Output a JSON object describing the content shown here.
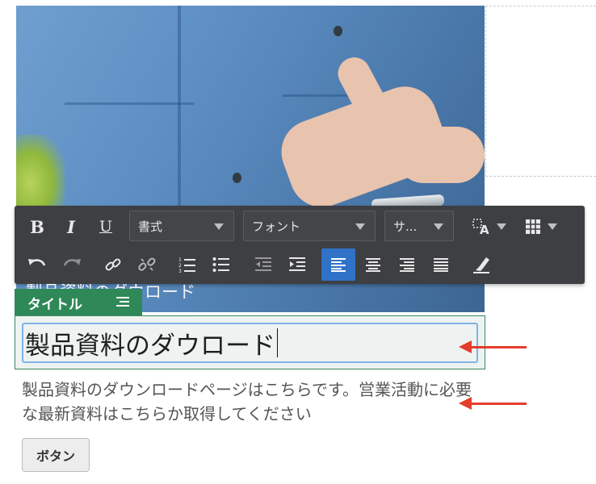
{
  "background_image": {
    "description_icon": "photo-person-with-phone"
  },
  "toolbar": {
    "bold_label": "B",
    "italic_label": "I",
    "underline_label": "U",
    "format_select": "書式",
    "font_select": "フォント",
    "size_select": "サ...",
    "icons": [
      "undo-icon",
      "redo-icon",
      "link-icon",
      "unlink-icon",
      "ordered-list-icon",
      "bullet-list-icon",
      "outdent-icon",
      "indent-icon",
      "align-left-icon",
      "align-center-icon",
      "align-right-icon",
      "align-justify-icon",
      "clear-format-icon",
      "text-style-icon",
      "table-icon"
    ],
    "active_color": "#2f72c8"
  },
  "content": {
    "behind_heading": "製品資料のダウロード",
    "badge_label": "タイトル",
    "title_value": "製品資料のダウロード",
    "description": "製品資料のダウンロードページはこちらです。営業活動に必要な最新資料はこちらか取得してください",
    "button_label": "ボタン"
  },
  "colors": {
    "badge": "#2f8858",
    "arrow": "#e53d2d",
    "toolbar": "#3d3f42",
    "focus_border": "#7fb3e6"
  }
}
